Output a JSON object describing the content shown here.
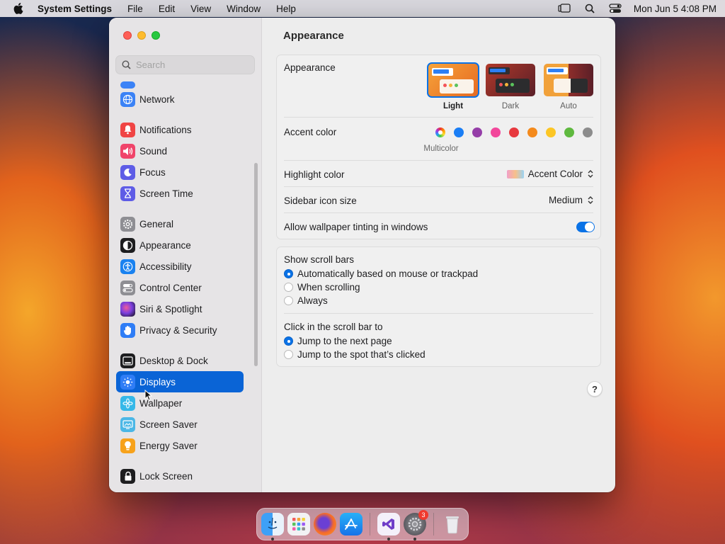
{
  "menubar": {
    "app_name": "System Settings",
    "items": [
      "File",
      "Edit",
      "View",
      "Window",
      "Help"
    ],
    "clock": "Mon Jun 5  4:08 PM"
  },
  "sidebar": {
    "search_placeholder": "Search",
    "items": [
      {
        "label": "Network",
        "icon": "globe-icon",
        "color": "#3b82f6"
      },
      {
        "label": "Notifications",
        "icon": "bell-icon",
        "color": "#f04444"
      },
      {
        "label": "Sound",
        "icon": "speaker-icon",
        "color": "#f0446a"
      },
      {
        "label": "Focus",
        "icon": "moon-icon",
        "color": "#5e5ce6"
      },
      {
        "label": "Screen Time",
        "icon": "hourglass-icon",
        "color": "#5e5ce6"
      },
      {
        "label": "General",
        "icon": "gear-icon",
        "color": "#8e8e93"
      },
      {
        "label": "Appearance",
        "icon": "appearance-icon",
        "color": "#1d1d1f"
      },
      {
        "label": "Accessibility",
        "icon": "accessibility-icon",
        "color": "#1a82f0"
      },
      {
        "label": "Control Center",
        "icon": "toggles-icon",
        "color": "#8e8e93"
      },
      {
        "label": "Siri & Spotlight",
        "icon": "siri-icon",
        "color": "#6a3fd4"
      },
      {
        "label": "Privacy & Security",
        "icon": "hand-icon",
        "color": "#2f7df6"
      },
      {
        "label": "Desktop & Dock",
        "icon": "dock-icon",
        "color": "#1d1d1f"
      },
      {
        "label": "Displays",
        "icon": "sun-icon",
        "color": "#2f7df6"
      },
      {
        "label": "Wallpaper",
        "icon": "flower-icon",
        "color": "#35b8e8"
      },
      {
        "label": "Screen Saver",
        "icon": "screensaver-icon",
        "color": "#4bb7e6"
      },
      {
        "label": "Energy Saver",
        "icon": "bulb-icon",
        "color": "#f7a21b"
      },
      {
        "label": "Lock Screen",
        "icon": "lock-icon",
        "color": "#1d1d1f"
      }
    ],
    "selected": "Displays"
  },
  "main": {
    "title": "Appearance",
    "appearance": {
      "label": "Appearance",
      "options": [
        {
          "label": "Light",
          "selected": true
        },
        {
          "label": "Dark",
          "selected": false
        },
        {
          "label": "Auto",
          "selected": false
        }
      ]
    },
    "accent": {
      "label": "Accent color",
      "caption": "Multicolor",
      "colors": [
        "multicolor",
        "#1a7ef5",
        "#953ea8",
        "#f2479b",
        "#e7393f",
        "#f48a1c",
        "#fcc625",
        "#5fb93f",
        "#8c8c8c"
      ]
    },
    "highlight": {
      "label": "Highlight color",
      "value": "Accent Color"
    },
    "sidebar_icon_size": {
      "label": "Sidebar icon size",
      "value": "Medium"
    },
    "wallpaper_tinting": {
      "label": "Allow wallpaper tinting in windows",
      "on": true
    },
    "scroll_bars": {
      "label": "Show scroll bars",
      "options": [
        "Automatically based on mouse or trackpad",
        "When scrolling",
        "Always"
      ],
      "selected": 0
    },
    "click_scroll": {
      "label": "Click in the scroll bar to",
      "options": [
        "Jump to the next page",
        "Jump to the spot that’s clicked"
      ],
      "selected": 0
    },
    "help_label": "?"
  },
  "dock": {
    "apps": [
      "finder-icon",
      "launchpad-icon",
      "firefox-icon",
      "app-store-icon",
      "visual-studio-icon",
      "system-settings-icon",
      "trash-icon"
    ],
    "settings_badge": "3"
  }
}
